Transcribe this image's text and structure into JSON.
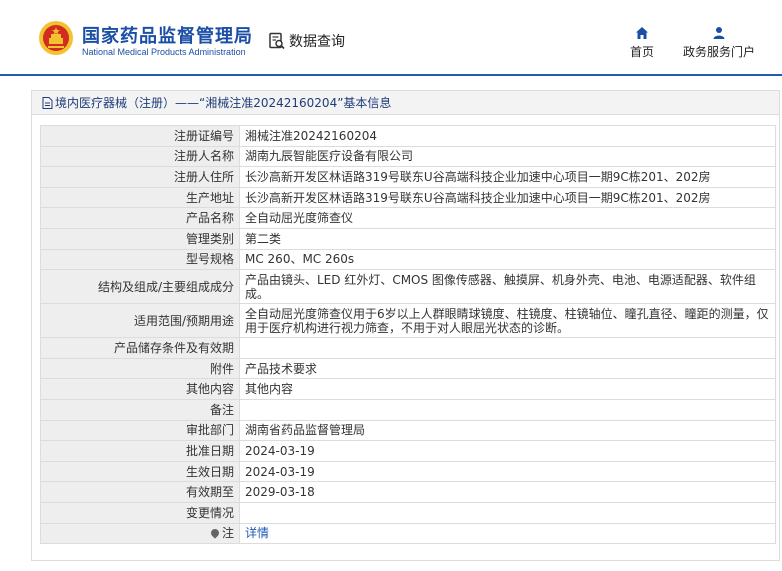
{
  "header": {
    "org_cn": "国家药品监督管理局",
    "org_en": "National Medical Products Administration",
    "data_query": "数据查询",
    "nav": {
      "home": "首页",
      "service": "政务服务门户"
    }
  },
  "breadcrumb": "境内医疗器械（注册）——“湘械注准20242160204”基本信息",
  "rows": [
    {
      "label": "注册证编号",
      "value": "湘械注准20242160204"
    },
    {
      "label": "注册人名称",
      "value": "湖南九辰智能医疗设备有限公司"
    },
    {
      "label": "注册人住所",
      "value": "长沙高新开发区林语路319号联东U谷高端科技企业加速中心项目一期9C栋201、202房"
    },
    {
      "label": "生产地址",
      "value": "长沙高新开发区林语路319号联东U谷高端科技企业加速中心项目一期9C栋201、202房"
    },
    {
      "label": "产品名称",
      "value": "全自动屈光度筛查仪"
    },
    {
      "label": "管理类别",
      "value": "第二类"
    },
    {
      "label": "型号规格",
      "value": "MC 260、MC 260s"
    },
    {
      "label": "结构及组成/主要组成成分",
      "value": "产品由镜头、LED 红外灯、CMOS 图像传感器、触摸屏、机身外壳、电池、电源适配器、软件组成。"
    },
    {
      "label": "适用范围/预期用途",
      "value": "全自动屈光度筛查仪用于6岁以上人群眼睛球镜度、柱镜度、柱镜轴位、瞳孔直径、瞳距的测量，仅用于医疗机构进行视力筛查，不用于对人眼屈光状态的诊断。"
    },
    {
      "label": "产品储存条件及有效期",
      "value": ""
    },
    {
      "label": "附件",
      "value": "产品技术要求"
    },
    {
      "label": "其他内容",
      "value": "其他内容"
    },
    {
      "label": "备注",
      "value": ""
    },
    {
      "label": "审批部门",
      "value": "湖南省药品监督管理局"
    },
    {
      "label": "批准日期",
      "value": "2024-03-19"
    },
    {
      "label": "生效日期",
      "value": "2024-03-19"
    },
    {
      "label": "有效期至",
      "value": "2029-03-18"
    },
    {
      "label": "变更情况",
      "value": ""
    },
    {
      "label": "注",
      "value": "详情"
    }
  ],
  "colors": {
    "brand_blue": "#1b4fa5",
    "emblem_red": "#d22b1f",
    "emblem_gold": "#f2c230",
    "link_blue": "#1f5bb4"
  },
  "icons": [
    "national-emblem-icon",
    "data-query-icon",
    "home-icon",
    "user-icon",
    "document-icon",
    "location-pin-icon"
  ]
}
